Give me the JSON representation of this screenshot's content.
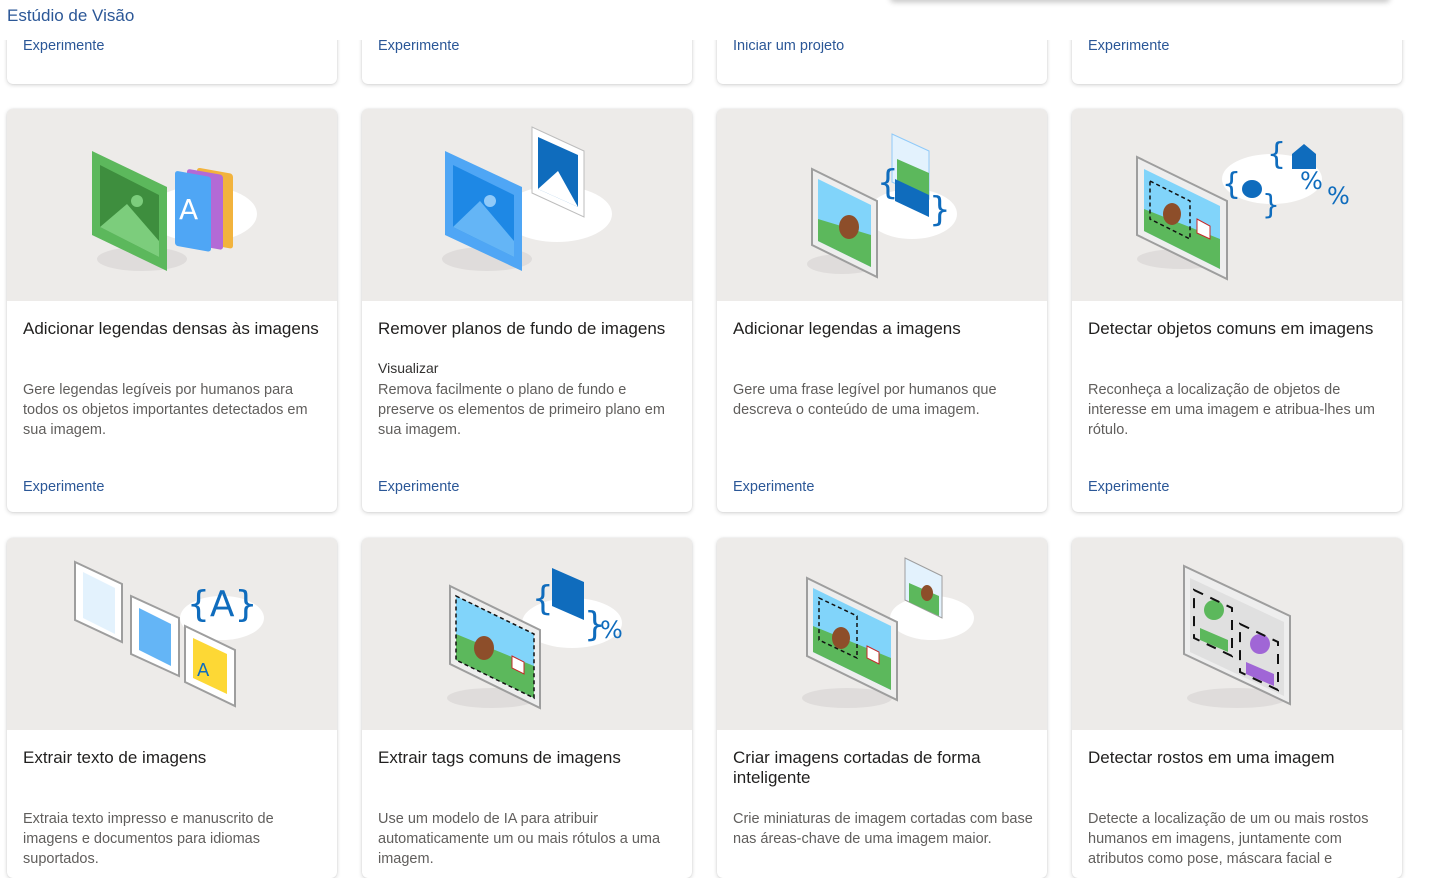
{
  "app": {
    "title": "Estúdio de Visão"
  },
  "top_row": [
    {
      "link": "Experimente"
    },
    {
      "link": "Experimente"
    },
    {
      "link": "Iniciar um projeto"
    },
    {
      "link": "Experimente"
    }
  ],
  "cards": [
    {
      "title": "Adicionar legendas densas às imagens",
      "badge": "",
      "description": "Gere legendas legíveis por humanos para todos os objetos importantes detectados em sua imagem.",
      "link": "Experimente",
      "illustration": "dense-captions-illustration"
    },
    {
      "title": "Remover planos de fundo de imagens",
      "badge": "Visualizar",
      "description": "Remova facilmente o plano de fundo e preserve os elementos de primeiro plano em sua imagem.",
      "link": "Experimente",
      "illustration": "background-removal-illustration"
    },
    {
      "title": "Adicionar legendas a imagens",
      "badge": "",
      "description": "Gere uma frase legível por humanos que descreva o conteúdo de uma imagem.",
      "link": "Experimente",
      "illustration": "image-caption-illustration"
    },
    {
      "title": "Detectar objetos comuns em imagens",
      "badge": "",
      "description": "Reconheça a localização de objetos de interesse em uma imagem e atribua-lhes um rótulo.",
      "link": "Experimente",
      "illustration": "object-detection-illustration"
    },
    {
      "title": "Extrair texto de imagens",
      "badge": "",
      "description": "Extraia texto impresso e manuscrito de imagens e documentos para idiomas suportados.",
      "link": "",
      "illustration": "ocr-illustration"
    },
    {
      "title": "Extrair tags comuns de imagens",
      "badge": "",
      "description": "Use um modelo de IA para atribuir automaticamente um ou mais rótulos a uma imagem.",
      "link": "",
      "illustration": "tagging-illustration"
    },
    {
      "title": "Criar imagens cortadas de forma inteligente",
      "badge": "",
      "description": "Crie miniaturas de imagem cortadas com base nas áreas-chave de uma imagem maior.",
      "link": "",
      "illustration": "smart-crop-illustration"
    },
    {
      "title": "Detectar rostos em uma imagem",
      "badge": "",
      "description": "Detecte a localização de um ou mais rostos humanos em imagens, juntamente com atributos como pose, máscara facial e",
      "link": "",
      "illustration": "face-detection-illustration"
    }
  ],
  "colors": {
    "link": "#2b5797",
    "thumb_bg": "#edebe9",
    "accent_blue": "#0f6cbd",
    "green": "#4caf50"
  }
}
